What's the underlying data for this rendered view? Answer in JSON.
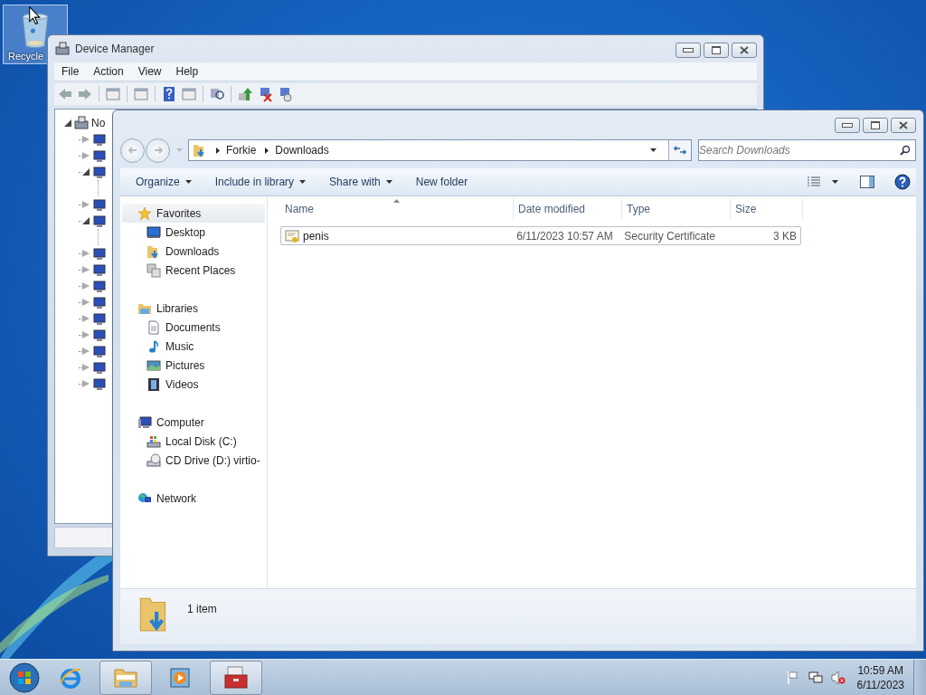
{
  "desktop": {
    "icons": [
      {
        "label": "Recycle",
        "selected": true
      }
    ]
  },
  "device_manager": {
    "title": "Device Manager",
    "menu": [
      "File",
      "Action",
      "View",
      "Help"
    ],
    "tree": {
      "label": "No",
      "expanded": true,
      "children": [
        {
          "expanded": false
        },
        {
          "expanded": false
        },
        {
          "expanded": true
        },
        {
          "expanded": false
        },
        {
          "expanded": true
        },
        {
          "expanded": false
        },
        {
          "expanded": false
        },
        {
          "expanded": false
        },
        {
          "expanded": false
        },
        {
          "expanded": false
        },
        {
          "expanded": false
        },
        {
          "expanded": false
        },
        {
          "expanded": false
        },
        {
          "expanded": false
        }
      ]
    }
  },
  "explorer": {
    "breadcrumb": [
      "Forkie",
      "Downloads"
    ],
    "search": {
      "placeholder": "Search Downloads"
    },
    "toolbar": [
      {
        "label": "Organize",
        "dropdown": true
      },
      {
        "label": "Include in library",
        "dropdown": true
      },
      {
        "label": "Share with",
        "dropdown": true
      },
      {
        "label": "New folder",
        "dropdown": false
      }
    ],
    "nav": [
      {
        "label": "Favorites",
        "kind": "favorites",
        "selected": true,
        "items": [
          {
            "label": "Desktop",
            "kind": "desktop",
            "selected": false
          },
          {
            "label": "Downloads",
            "kind": "downloads",
            "selected": false
          },
          {
            "label": "Recent Places",
            "kind": "recent",
            "selected": false
          }
        ]
      },
      {
        "label": "Libraries",
        "kind": "libraries",
        "selected": false,
        "items": [
          {
            "label": "Documents",
            "kind": "documents",
            "selected": false
          },
          {
            "label": "Music",
            "kind": "music",
            "selected": false
          },
          {
            "label": "Pictures",
            "kind": "pictures",
            "selected": false
          },
          {
            "label": "Videos",
            "kind": "videos",
            "selected": false
          }
        ]
      },
      {
        "label": "Computer",
        "kind": "computer",
        "selected": false,
        "items": [
          {
            "label": "Local Disk (C:)",
            "kind": "disk",
            "selected": false
          },
          {
            "label": "CD Drive (D:) virtio-",
            "kind": "cd",
            "selected": false
          }
        ]
      },
      {
        "label": "Network",
        "kind": "network",
        "selected": false
      }
    ],
    "columns": [
      {
        "label": "Name",
        "sorted": true
      },
      {
        "label": "Date modified",
        "sorted": false
      },
      {
        "label": "Type",
        "sorted": false
      },
      {
        "label": "Size",
        "sorted": false
      }
    ],
    "rows": [
      {
        "name": "penis",
        "date_modified": "6/11/2023 10:57 AM",
        "type": "Security Certificate",
        "size": "3 KB",
        "focused": true
      }
    ],
    "status": "1 item"
  },
  "taskbar": {
    "buttons": [
      {
        "kind": "ie",
        "active": false
      },
      {
        "kind": "explorer",
        "active": true
      },
      {
        "kind": "media",
        "active": false
      },
      {
        "kind": "toolbox",
        "active": true
      }
    ],
    "tray": {
      "volume_muted": true,
      "time": "10:59 AM",
      "date": "6/11/2023"
    }
  }
}
